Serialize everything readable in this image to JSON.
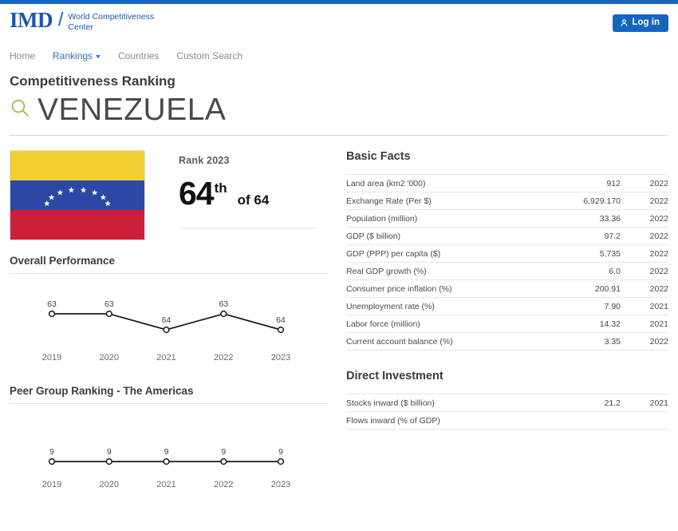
{
  "brand": {
    "logo_main": "IMD",
    "logo_slash": "/",
    "logo_sub": "World Competitiveness Center",
    "accent_blue": "#1565c0",
    "logo_blue": "#1a56a8"
  },
  "header": {
    "login_label": "Log in"
  },
  "nav": {
    "items": [
      {
        "label": "Home",
        "active": false,
        "caret": false
      },
      {
        "label": "Rankings",
        "active": true,
        "caret": true
      },
      {
        "label": "Countries",
        "active": false,
        "caret": false
      },
      {
        "label": "Custom Search",
        "active": false,
        "caret": false
      }
    ]
  },
  "page": {
    "title": "Competitiveness Ranking",
    "country": "VENEZUELA",
    "search_icon_color": "#9dbb55"
  },
  "flag": {
    "alt": "Venezuela flag",
    "band_top": "#f0cf2e",
    "band_middle": "#2d47a5",
    "band_bottom": "#cc1f3a",
    "star_count": 8,
    "star_color": "#ffffff"
  },
  "rank": {
    "label": "Rank 2023",
    "number": "64",
    "suffix": "th",
    "of": "of 64"
  },
  "chart_data": [
    {
      "type": "line",
      "title": "Overall Performance",
      "categories": [
        "2019",
        "2020",
        "2021",
        "2022",
        "2023"
      ],
      "values": [
        63,
        63,
        64,
        63,
        64
      ],
      "labels": [
        "63",
        "63",
        "64",
        "63",
        "64"
      ],
      "xlabel": "",
      "ylabel": "",
      "ylim": [
        63,
        64
      ],
      "inverted_y": true,
      "grid": false,
      "legend": "none",
      "marker": "open-circle",
      "line_color": "#1a1a1a"
    },
    {
      "type": "line",
      "title": "Peer Group Ranking - The Americas",
      "categories": [
        "2019",
        "2020",
        "2021",
        "2022",
        "2023"
      ],
      "values": [
        9,
        9,
        9,
        9,
        9
      ],
      "labels": [
        "9",
        "9",
        "9",
        "9",
        "9"
      ],
      "xlabel": "",
      "ylabel": "",
      "ylim": [
        9,
        9
      ],
      "inverted_y": true,
      "grid": false,
      "legend": "none",
      "marker": "open-circle",
      "line_color": "#1a1a1a"
    }
  ],
  "basic_facts": {
    "title": "Basic Facts",
    "rows": [
      {
        "label": "Land area (km2 '000)",
        "value": "912",
        "year": "2022"
      },
      {
        "label": "Exchange Rate (Per $)",
        "value": "6,929.170",
        "year": "2022"
      },
      {
        "label": "Population (million)",
        "value": "33.36",
        "year": "2022"
      },
      {
        "label": "GDP ($ billion)",
        "value": "97.2",
        "year": "2022"
      },
      {
        "label": "GDP (PPP) per capita ($)",
        "value": "5,735",
        "year": "2022"
      },
      {
        "label": "Real GDP growth (%)",
        "value": "6.0",
        "year": "2022"
      },
      {
        "label": "Consumer price inflation (%)",
        "value": "200.91",
        "year": "2022"
      },
      {
        "label": "Unemployment rate (%)",
        "value": "7.90",
        "year": "2021"
      },
      {
        "label": "Labor force (million)",
        "value": "14.32",
        "year": "2021"
      },
      {
        "label": "Current account balance (%)",
        "value": "3.35",
        "year": "2022"
      }
    ]
  },
  "direct_investment": {
    "title": "Direct Investment",
    "rows": [
      {
        "label": "Stocks inward ($ billion)",
        "value": "21.2",
        "year": "2021"
      },
      {
        "label": "Flows inward (% of GDP)",
        "value": "",
        "year": ""
      }
    ]
  }
}
